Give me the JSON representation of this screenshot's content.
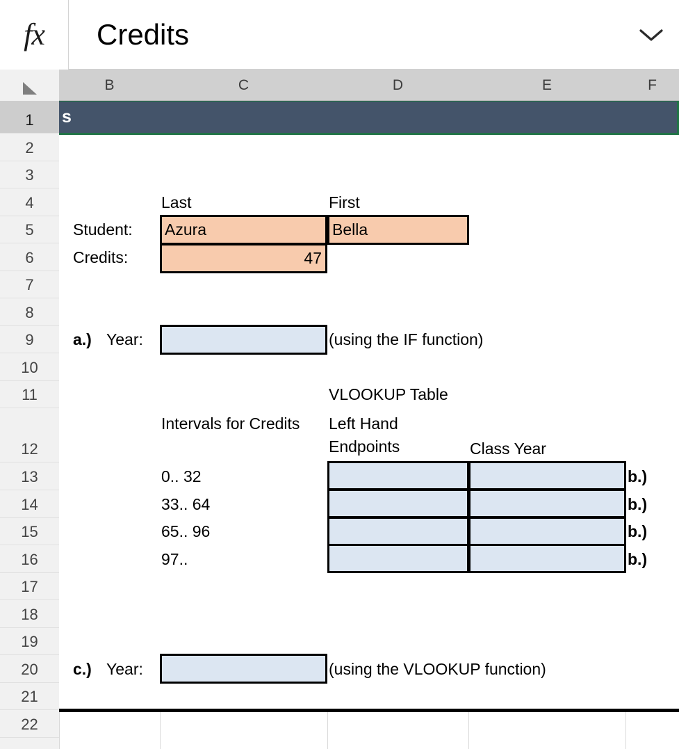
{
  "app": {
    "formula_bar": {
      "fx_icon": "fx-icon",
      "value": "Credits",
      "placeholder": "",
      "expand_icon": "chevron-down-icon"
    }
  },
  "grid": {
    "select_all_icon": "select-all-triangle-icon",
    "column_headers": [
      "B",
      "C",
      "D",
      "E",
      "F"
    ],
    "row_headers": [
      "1",
      "2",
      "3",
      "4",
      "5",
      "6",
      "7",
      "8",
      "9",
      "10",
      "11",
      "12",
      "13",
      "14",
      "15",
      "16",
      "17",
      "18",
      "19",
      "20",
      "21",
      "22"
    ],
    "selected_row": "1",
    "colors": {
      "banner_fill": "#44546a",
      "input_fill": "#dce6f2",
      "data_fill": "#f8cbad",
      "selection_border": "#217346",
      "header_fill": "#d0d0d0",
      "row_header_fill": "#f1f1f1"
    }
  },
  "cells": {
    "banner": {
      "row": "1",
      "text": "s"
    },
    "label_last": {
      "row": "4",
      "col": "C",
      "text": "Last"
    },
    "label_first": {
      "row": "4",
      "col": "D",
      "text": "First"
    },
    "label_student": {
      "row": "5",
      "col": "B",
      "text": "Student:"
    },
    "student_last": {
      "row": "5",
      "col": "C",
      "text": "Azura"
    },
    "student_first": {
      "row": "5",
      "col": "D",
      "text": "Bella"
    },
    "label_credits": {
      "row": "6",
      "col": "B",
      "text": "Credits:"
    },
    "credits_value": {
      "row": "6",
      "col": "C",
      "text": "47"
    },
    "part_a_marker": {
      "row": "9",
      "col": "B",
      "text": "a.)"
    },
    "part_a_label": {
      "row": "9",
      "col": "B",
      "text": "Year:"
    },
    "part_a_answer": {
      "row": "9",
      "col": "C",
      "text": ""
    },
    "part_a_note": {
      "row": "9",
      "col": "D",
      "text": "(using the IF function)"
    },
    "vlookup_title": {
      "row": "11",
      "col": "D",
      "text": "VLOOKUP Table"
    },
    "intervals_header": {
      "row": "12",
      "col": "C",
      "text": "Intervals for Credits"
    },
    "endpoints_header": {
      "row": "12",
      "col": "D",
      "text": "Left Hand Endpoints"
    },
    "classyear_header": {
      "row": "12",
      "col": "E",
      "text": "Class Year"
    },
    "interval_rows": [
      {
        "row": "13",
        "interval": "0.. 32",
        "endpoint": "",
        "class_year": "",
        "marker": "b.)"
      },
      {
        "row": "14",
        "interval": "33.. 64",
        "endpoint": "",
        "class_year": "",
        "marker": "b.)"
      },
      {
        "row": "15",
        "interval": "65.. 96",
        "endpoint": "",
        "class_year": "",
        "marker": "b.)"
      },
      {
        "row": "16",
        "interval": "97..",
        "endpoint": "",
        "class_year": "",
        "marker": "b.)"
      }
    ],
    "part_c_marker": {
      "row": "20",
      "col": "B",
      "text": "c.)"
    },
    "part_c_label": {
      "row": "20",
      "col": "B",
      "text": "Year:"
    },
    "part_c_answer": {
      "row": "20",
      "col": "C",
      "text": ""
    },
    "part_c_note": {
      "row": "20",
      "col": "D",
      "text": "(using the VLOOKUP function)"
    }
  }
}
